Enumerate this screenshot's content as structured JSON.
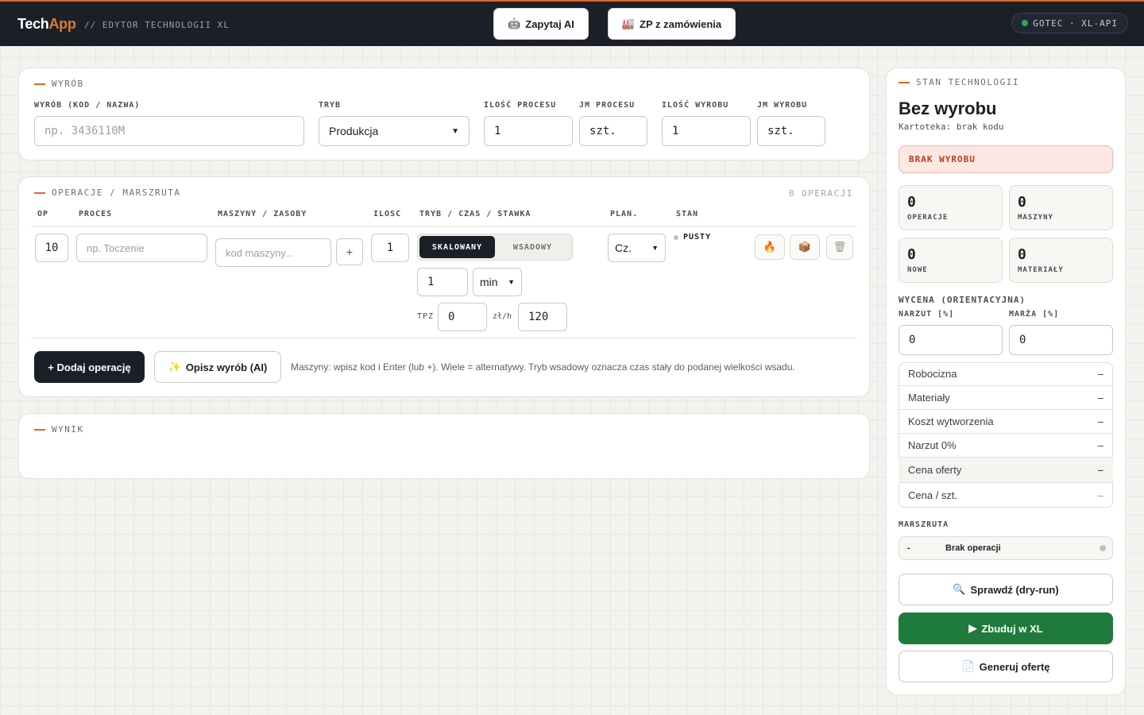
{
  "app": {
    "name_a": "Tech",
    "name_b": "App",
    "subtitle": "// EDYTOR TECHNOLOGII XL"
  },
  "header": {
    "ask_ai_label": "Zapytaj AI",
    "ask_ai_icon": "robot-icon",
    "zp_label": "ZP z zamówienia",
    "zp_icon": "factory-icon",
    "connection_status": "GOTEC · XL-API",
    "connection_color": "#2fa55a"
  },
  "product": {
    "section_title": "WYRÓB",
    "product_label": "WYRÓB (KOD / NAZWA)",
    "product_placeholder": "np. 3436110M",
    "mode_label": "TRYB",
    "mode_value": "Produkcja",
    "process_qty_label": "ILOŚĆ PROCESU",
    "process_qty": "1",
    "process_unit_label": "JM PROCESU",
    "process_unit": "szt.",
    "product_qty_label": "ILOŚĆ WYROBU",
    "product_qty": "1",
    "product_unit_label": "JM WYROBU",
    "product_unit": "szt."
  },
  "operations": {
    "section_title": "OPERACJE / MARSZRUTA",
    "count_label": "0 OPERACJI",
    "columns": [
      "OP",
      "PROCES",
      "MASZYNY / ZASOBY",
      "ILOSC",
      "TRYB / CZAS / STAWKA",
      "PLAN.",
      "STAN"
    ],
    "row": {
      "op": "10",
      "process_placeholder": "np. Toczenie",
      "machine_placeholder": "kod maszyny...",
      "add_machine": "+",
      "qty": "1",
      "mode_scaled": "SKALOWANY",
      "mode_batch": "WSADOWY",
      "time": "1",
      "time_unit": "min",
      "tpz_label": "TPZ",
      "tpz": "0",
      "rate_label": "zł/h",
      "rate": "120",
      "plan": "Cz.",
      "state": "PUSTY"
    },
    "add_button": "+ Dodaj operację",
    "describe_button": "Opisz wyrób (AI)",
    "hint": "Maszyny: wpisz kod i Enter (lub +). Wiele = alternatywy. Tryb wsadowy oznacza czas stały do podanej wielkości wsadu."
  },
  "result": {
    "section_title": "WYNIK"
  },
  "tech_state": {
    "section_title": "STAN TECHNOLOGII",
    "title": "Bez wyrobu",
    "card_info": "Kartoteka: brak kodu",
    "alert": "BRAK WYROBU",
    "stats": [
      {
        "value": "0",
        "label": "OPERACJE"
      },
      {
        "value": "0",
        "label": "MASZYNY"
      },
      {
        "value": "0",
        "label": "NOWE"
      },
      {
        "value": "0",
        "label": "MATERIAŁY"
      }
    ],
    "pricing_title": "WYCENA (ORIENTACYJNA)",
    "markup_label": "NARZUT [%]",
    "markup": "0",
    "margin_label": "MARŻA [%]",
    "margin": "0",
    "costs": [
      {
        "label": "Robocizna",
        "value": "–"
      },
      {
        "label": "Materiały",
        "value": "–"
      },
      {
        "label": "Koszt wytworzenia",
        "value": "–"
      },
      {
        "label": "Narzut 0%",
        "value": "–"
      },
      {
        "label": "Cena oferty",
        "value": "–"
      },
      {
        "label": "Cena / szt.",
        "value": "–"
      }
    ],
    "route_title": "MARSZRUTA",
    "route_dash": "-",
    "route_empty": "Brak operacji",
    "check_button": "Sprawdź (dry-run)",
    "build_button": "Zbuduj w XL",
    "offer_button": "Generuj ofertę",
    "accent_green": "#1f7a3e"
  }
}
